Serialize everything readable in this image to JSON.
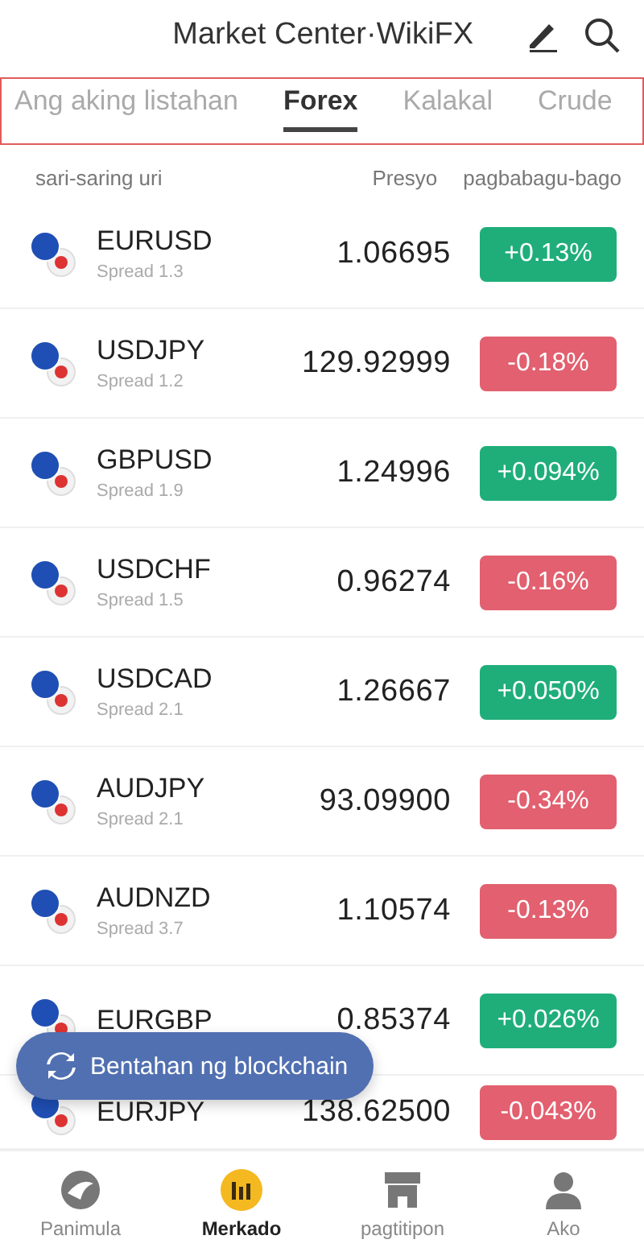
{
  "header": {
    "title": "Market Center·WikiFX"
  },
  "tabs": [
    {
      "label": "Ang aking listahan",
      "selected": false
    },
    {
      "label": "Forex",
      "selected": true
    },
    {
      "label": "Kalakal",
      "selected": false
    },
    {
      "label": "Crude",
      "selected": false
    }
  ],
  "columns": [
    "sari-saring uri",
    "Presyo",
    "pagbabagu-bago"
  ],
  "rows": [
    {
      "symbol": "EURUSD",
      "spread": "Spread 1.3",
      "price": "1.06695",
      "change": "+0.13%",
      "rising": true
    },
    {
      "symbol": "USDJPY",
      "spread": "Spread 1.2",
      "price": "129.92999",
      "change": "-0.18%",
      "rising": false
    },
    {
      "symbol": "GBPUSD",
      "spread": "Spread 1.9",
      "price": "1.24996",
      "change": "+0.094%",
      "rising": true
    },
    {
      "symbol": "USDCHF",
      "spread": "Spread 1.5",
      "price": "0.96274",
      "change": "-0.16%",
      "rising": false
    },
    {
      "symbol": "USDCAD",
      "spread": "Spread 2.1",
      "price": "1.26667",
      "change": "+0.050%",
      "rising": true
    },
    {
      "symbol": "AUDJPY",
      "spread": "Spread 2.1",
      "price": "93.09900",
      "change": "-0.34%",
      "rising": false
    },
    {
      "symbol": "AUDNZD",
      "spread": "Spread 3.7",
      "price": "1.10574",
      "change": "-0.13%",
      "rising": false
    },
    {
      "symbol": "EURGBP",
      "price": "0.85374",
      "change": "+0.026%",
      "rising": true
    },
    {
      "symbol": "EURJPY",
      "price": "138.62500",
      "change": "-0.043%",
      "rising": false
    }
  ],
  "floating_button": {
    "label": "Bentahan ng blockchain"
  },
  "nav": [
    {
      "label": "Panimula",
      "kind": "home",
      "selected": false
    },
    {
      "label": "Merkado",
      "kind": "market",
      "selected": true
    },
    {
      "label": "pagtitipon",
      "kind": "store",
      "selected": false
    },
    {
      "label": "Ako",
      "kind": "profile",
      "selected": false
    }
  ]
}
